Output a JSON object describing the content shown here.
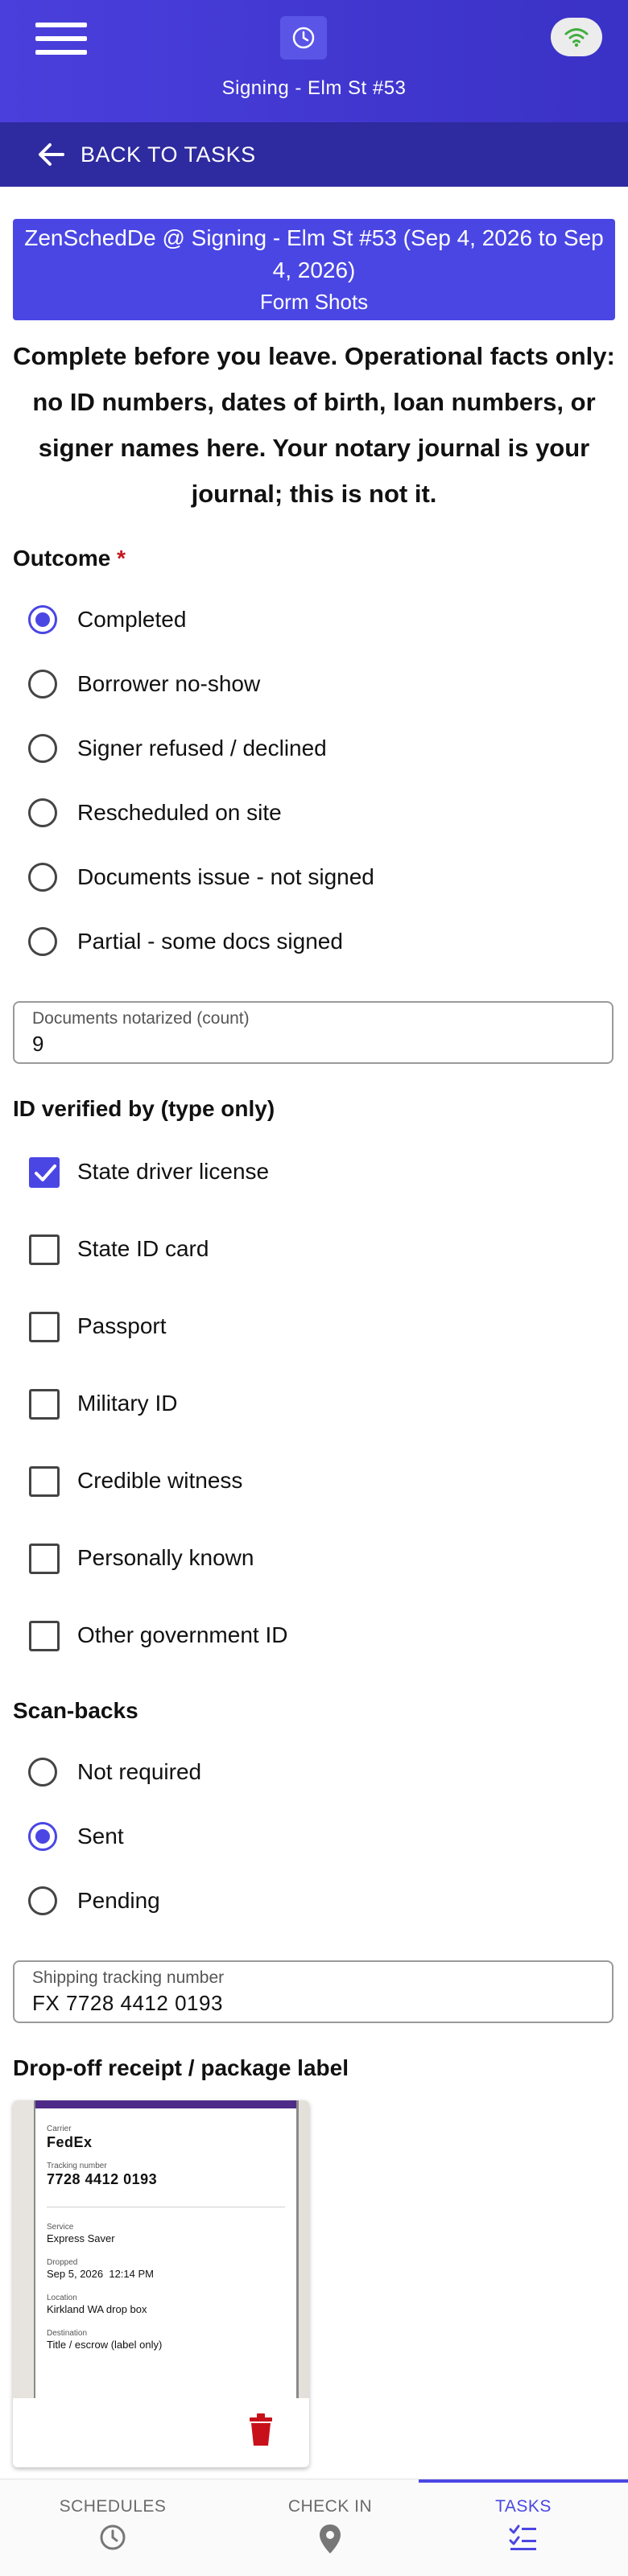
{
  "header": {
    "title": "Signing - Elm St #53",
    "back_label": "BACK TO TASKS",
    "icons": {
      "menu": "hamburger-icon",
      "logo": "clock-icon",
      "status": "wifi-icon",
      "back": "arrow-left-icon"
    }
  },
  "banner": {
    "title": "ZenSchedDe @ Signing - Elm St #53 (Sep 4, 2026 to Sep 4, 2026)",
    "subtitle": "Form Shots"
  },
  "intro": "Complete before you leave. Operational facts only: no ID numbers, dates of birth, loan numbers, or signer names here. Your notary journal is your journal; this is not it.",
  "outcome": {
    "label": "Outcome",
    "required_mark": "*",
    "selected": "Completed",
    "options": [
      "Completed",
      "Borrower no-show",
      "Signer refused / declined",
      "Rescheduled on site",
      "Documents issue - not signed",
      "Partial - some docs signed"
    ]
  },
  "docs_count": {
    "label": "Documents notarized (count)",
    "value": "9"
  },
  "id_verified": {
    "label": "ID verified by (type only)",
    "options": [
      {
        "label": "State driver license",
        "checked": true
      },
      {
        "label": "State ID card",
        "checked": false
      },
      {
        "label": "Passport",
        "checked": false
      },
      {
        "label": "Military ID",
        "checked": false
      },
      {
        "label": "Credible witness",
        "checked": false
      },
      {
        "label": "Personally known",
        "checked": false
      },
      {
        "label": "Other government ID",
        "checked": false
      }
    ]
  },
  "scanbacks": {
    "label": "Scan-backs",
    "selected": "Sent",
    "options": [
      "Not required",
      "Sent",
      "Pending"
    ]
  },
  "tracking": {
    "label": "Shipping tracking number",
    "value": "FX 7728 4412 0193"
  },
  "receipt": {
    "label": "Drop-off receipt / package label",
    "photo": {
      "carrier_label": "Carrier",
      "carrier": "FedEx",
      "tracking_label": "Tracking number",
      "tracking": "7728 4412 0193",
      "service_label": "Service",
      "service": "Express Saver",
      "dropped_label": "Dropped",
      "dropped": "Sep 5, 2026  12:14 PM",
      "location_label": "Location",
      "location": "Kirkland WA drop box",
      "destination_label": "Destination",
      "destination": "Title / escrow (label only)"
    },
    "delete_icon": "trash-icon"
  },
  "bottom_nav": {
    "active": "TASKS",
    "items": [
      {
        "label": "SCHEDULES",
        "icon": "clock-icon"
      },
      {
        "label": "CHECK IN",
        "icon": "map-pin-icon"
      },
      {
        "label": "TASKS",
        "icon": "checklist-icon"
      }
    ]
  },
  "colors": {
    "primary": "#4a46e4",
    "header": "#3a31c6",
    "back_bar": "#2e2a9f",
    "required": "#c4151c",
    "delete": "#c8101a"
  }
}
